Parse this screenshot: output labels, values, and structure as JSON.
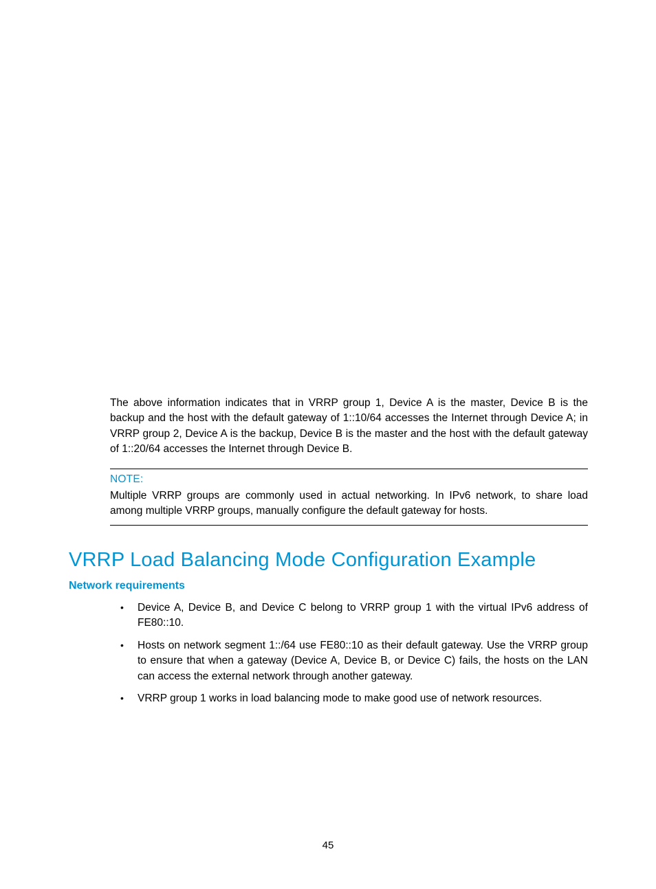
{
  "para1": "The above information indicates that in VRRP group 1, Device A is the master, Device B is the backup and the host with the default gateway of 1::10/64 accesses the Internet through Device A; in VRRP group 2, Device A is the backup, Device B is the master and the host with the default gateway of 1::20/64 accesses the Internet through Device B.",
  "note": {
    "label": "NOTE:",
    "text": "Multiple VRRP groups are commonly used in actual networking. In IPv6 network, to share load among multiple VRRP groups, manually configure the default gateway for hosts."
  },
  "heading": "VRRP Load Balancing Mode Configuration Example",
  "subheading": "Network requirements",
  "bullets": [
    "Device A, Device B, and Device C belong to VRRP group 1 with the virtual IPv6 address of FE80::10.",
    "Hosts on network segment 1::/64 use FE80::10 as their default gateway. Use the VRRP group to ensure that when a gateway (Device A, Device B, or Device C) fails, the hosts on the LAN can access the external network through another gateway.",
    "VRRP group 1 works in load balancing mode to make good use of network resources."
  ],
  "page_number": "45"
}
